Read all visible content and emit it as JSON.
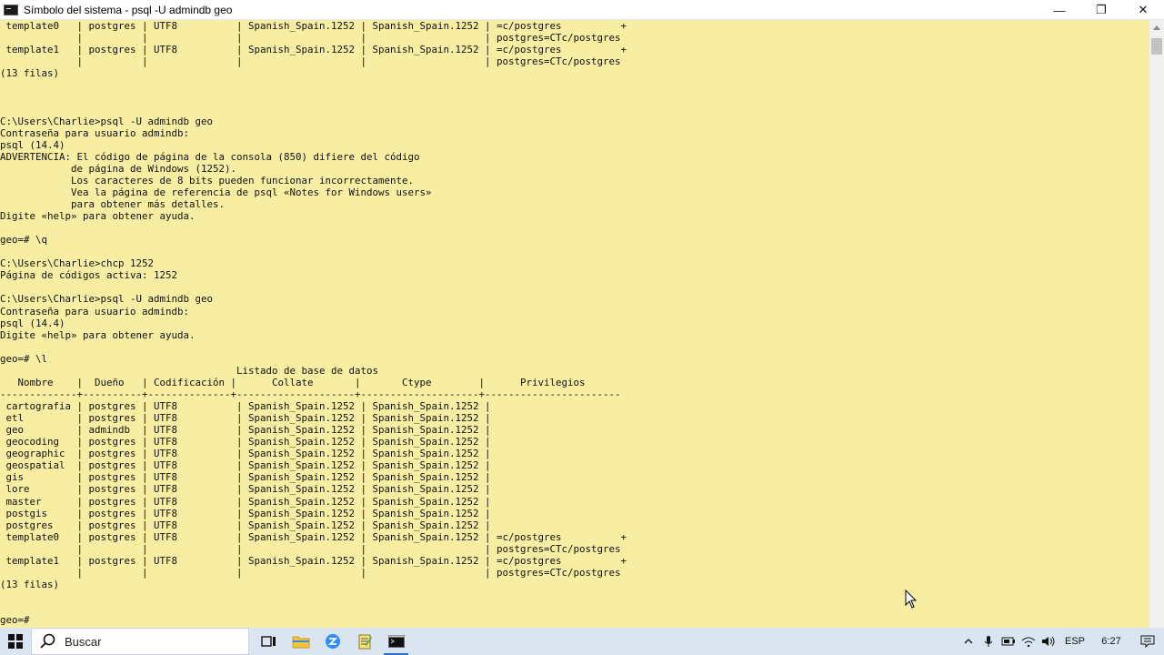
{
  "window": {
    "title": "Símbolo del sistema - psql  -U admindb geo",
    "minimize": "—",
    "maximize": "❐",
    "close": "✕"
  },
  "console": {
    "text": " template0   | postgres | UTF8          | Spanish_Spain.1252 | Spanish_Spain.1252 | =c/postgres          +\n             |          |               |                    |                    | postgres=CTc/postgres\n template1   | postgres | UTF8          | Spanish_Spain.1252 | Spanish_Spain.1252 | =c/postgres          +\n             |          |               |                    |                    | postgres=CTc/postgres\n(13 filas)\n\n\n\nC:\\Users\\Charlie>psql -U admindb geo\nContraseña para usuario admindb:\npsql (14.4)\nADVERTENCIA: El código de página de la consola (850) difiere del código\n            de página de Windows (1252).\n            Los caracteres de 8 bits pueden funcionar incorrectamente.\n            Vea la página de referencia de psql «Notes for Windows users»\n            para obtener más detalles.\nDigite «help» para obtener ayuda.\n\ngeo=# \\q\n\nC:\\Users\\Charlie>chcp 1252\nPágina de códigos activa: 1252\n\nC:\\Users\\Charlie>psql -U admindb geo\nContraseña para usuario admindb:\npsql (14.4)\nDigite «help» para obtener ayuda.\n\ngeo=# \\l\n                                        Listado de base de datos\n   Nombre    |  Dueño   | Codificación |      Collate       |       Ctype        |      Privilegios\n-------------+----------+--------------+--------------------+--------------------+-----------------------\n cartografia | postgres | UTF8          | Spanish_Spain.1252 | Spanish_Spain.1252 |\n etl         | postgres | UTF8          | Spanish_Spain.1252 | Spanish_Spain.1252 |\n geo         | admindb  | UTF8          | Spanish_Spain.1252 | Spanish_Spain.1252 |\n geocoding   | postgres | UTF8          | Spanish_Spain.1252 | Spanish_Spain.1252 |\n geographic  | postgres | UTF8          | Spanish_Spain.1252 | Spanish_Spain.1252 |\n geospatial  | postgres | UTF8          | Spanish_Spain.1252 | Spanish_Spain.1252 |\n gis         | postgres | UTF8          | Spanish_Spain.1252 | Spanish_Spain.1252 |\n lore        | postgres | UTF8          | Spanish_Spain.1252 | Spanish_Spain.1252 |\n master      | postgres | UTF8          | Spanish_Spain.1252 | Spanish_Spain.1252 |\n postgis     | postgres | UTF8          | Spanish_Spain.1252 | Spanish_Spain.1252 |\n postgres    | postgres | UTF8          | Spanish_Spain.1252 | Spanish_Spain.1252 |\n template0   | postgres | UTF8          | Spanish_Spain.1252 | Spanish_Spain.1252 | =c/postgres          +\n             |          |               |                    |                    | postgres=CTc/postgres\n template1   | postgres | UTF8          | Spanish_Spain.1252 | Spanish_Spain.1252 | =c/postgres          +\n             |          |               |                    |                    | postgres=CTc/postgres\n(13 filas)\n\n\ngeo=#",
    "background": "#f7eea4",
    "foreground": "#101010"
  },
  "taskbar": {
    "search_placeholder": "Buscar",
    "apps": [
      "task-view-icon",
      "file-explorer-icon",
      "zoom-icon",
      "notepad-icon",
      "command-prompt-icon"
    ],
    "language": "ESP",
    "time": "6:27",
    "accent": "#2a6fd6"
  }
}
